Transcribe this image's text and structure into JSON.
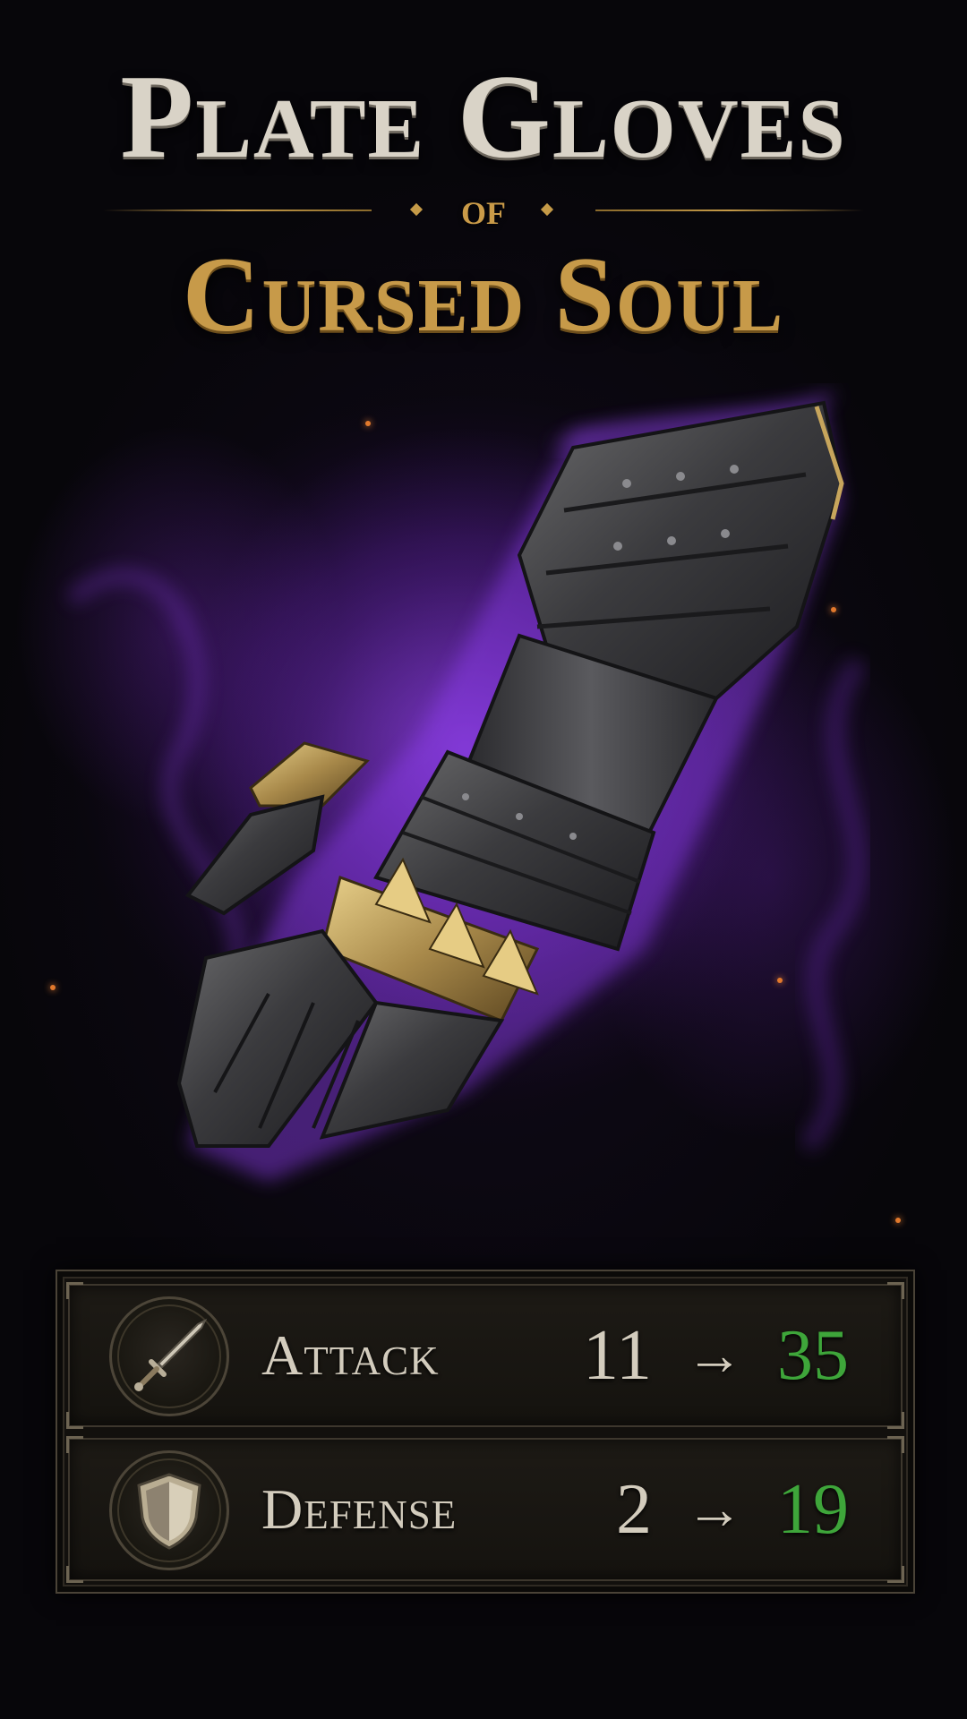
{
  "item": {
    "title_line1": "Plate Gloves",
    "title_of": "of",
    "title_line3": "Cursed Soul"
  },
  "stats": [
    {
      "label": "Attack",
      "icon": "sword-icon",
      "from": "11",
      "arrow": "→",
      "to": "35"
    },
    {
      "label": "Defense",
      "icon": "shield-icon",
      "from": "2",
      "arrow": "→",
      "to": "19"
    }
  ],
  "colors": {
    "title_silver": "#d9d3c7",
    "title_gold": "#c79a49",
    "aura_purple": "#7630c4",
    "stat_increase_green": "#3ea53a"
  }
}
